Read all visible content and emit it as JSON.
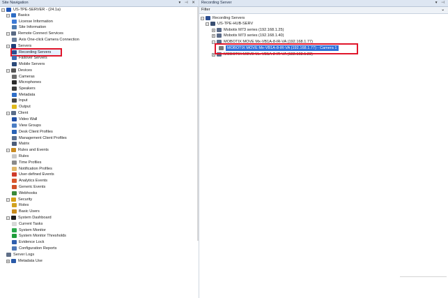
{
  "left_pane": {
    "title": "Site Navigation",
    "controls": "▾ ⊣ ✕",
    "tree": [
      {
        "label": "US-TPE-SERVER - (24.1a)",
        "icon": "server-root-icon",
        "color": "#1f56b8",
        "expand": "−"
      },
      {
        "label": "Basics",
        "icon": "folder-icon",
        "color": "#2d6cc4",
        "expand": "−"
      },
      {
        "label": "License Information",
        "icon": "license-icon",
        "color": "#3d7bd6"
      },
      {
        "label": "Site Information",
        "icon": "site-icon",
        "color": "#4a79b0"
      },
      {
        "label": "Remote Connect Services",
        "icon": "remote-icon",
        "color": "#5a6a84",
        "expand": "−"
      },
      {
        "label": "Axis One-click Camera Connection",
        "icon": "camera-connection-icon",
        "color": "#6a7f9c"
      },
      {
        "label": "Servers",
        "icon": "servers-icon",
        "color": "#1e3d78",
        "expand": "−"
      },
      {
        "label": "Recording Servers",
        "icon": "recording-server-icon",
        "color": "#2b4e92"
      },
      {
        "label": "Failover Servers",
        "icon": "failover-server-icon",
        "color": "#3b6cb2"
      },
      {
        "label": "Mobile Servers",
        "icon": "mobile-server-icon",
        "color": "#2b4a7a"
      },
      {
        "label": "Devices",
        "icon": "devices-icon",
        "color": "#555",
        "expand": "−"
      },
      {
        "label": "Cameras",
        "icon": "camera-icon",
        "color": "#6d6d6d"
      },
      {
        "label": "Microphones",
        "icon": "microphone-icon",
        "color": "#2b2b2b"
      },
      {
        "label": "Speakers",
        "icon": "speaker-icon",
        "color": "#3c3c3c"
      },
      {
        "label": "Metadata",
        "icon": "metadata-icon",
        "color": "#2f6ec8"
      },
      {
        "label": "Input",
        "icon": "input-icon",
        "color": "#474747"
      },
      {
        "label": "Output",
        "icon": "output-icon",
        "color": "#e0b91c"
      },
      {
        "label": "Client",
        "icon": "client-icon",
        "color": "#5b6e8a",
        "expand": "−"
      },
      {
        "label": "Video Wall",
        "icon": "video-wall-icon",
        "color": "#2251a8"
      },
      {
        "label": "View Groups",
        "icon": "view-groups-icon",
        "color": "#4a7dc4"
      },
      {
        "label": "Desk Client Profiles",
        "icon": "desk-client-icon",
        "color": "#2a63b6"
      },
      {
        "label": "Management Client Profiles",
        "icon": "management-client-icon",
        "color": "#5a6f90"
      },
      {
        "label": "Matrix",
        "icon": "matrix-icon",
        "color": "#4c5d7a"
      },
      {
        "label": "Rules and Events",
        "icon": "rules-events-icon",
        "color": "#c98a20",
        "expand": "−"
      },
      {
        "label": "Rules",
        "icon": "rules-icon",
        "color": "#c7c7c7"
      },
      {
        "label": "Time Profiles",
        "icon": "time-profiles-icon",
        "color": "#8a8a8a"
      },
      {
        "label": "Notification Profiles",
        "icon": "notification-icon",
        "color": "#e0b86a"
      },
      {
        "label": "User-defined Events",
        "icon": "user-event-icon",
        "color": "#cf3b2c"
      },
      {
        "label": "Analytics Events",
        "icon": "analytics-event-icon",
        "color": "#d9552c"
      },
      {
        "label": "Generic Events",
        "icon": "generic-event-icon",
        "color": "#d0502a"
      },
      {
        "label": "Webhooks",
        "icon": "webhooks-icon",
        "color": "#3a8a3a"
      },
      {
        "label": "Security",
        "icon": "security-icon",
        "color": "#d4a017",
        "expand": "−"
      },
      {
        "label": "Roles",
        "icon": "roles-icon",
        "color": "#d1a21f"
      },
      {
        "label": "Basic Users",
        "icon": "basic-users-icon",
        "color": "#c98b1c"
      },
      {
        "label": "System Dashboard",
        "icon": "dashboard-icon",
        "color": "#1e1e1e",
        "expand": "−"
      },
      {
        "label": "Current Tasks",
        "icon": "tasks-icon",
        "color": "#d8d8d8"
      },
      {
        "label": "System Monitor",
        "icon": "system-monitor-icon",
        "color": "#2aa84a"
      },
      {
        "label": "System Monitor Thresholds",
        "icon": "thresholds-icon",
        "color": "#1f9d3a"
      },
      {
        "label": "Evidence Lock",
        "icon": "evidence-lock-icon",
        "color": "#2f5fae"
      },
      {
        "label": "Configuration Reports",
        "icon": "reports-icon",
        "color": "#4f78b6"
      },
      {
        "label": "Server Logs",
        "icon": "server-logs-icon",
        "color": "#5f6f88"
      },
      {
        "label": "Metadata Use",
        "icon": "metadata-use-icon",
        "color": "#2a5aa8",
        "expand": "+"
      }
    ]
  },
  "right_pane": {
    "title": "Recording Server",
    "pin": "▾ ⊣",
    "filter_label": "Filter",
    "filter_chevron": "⌄",
    "tree": [
      {
        "label": "Recording Servers",
        "icon": "recording-servers-icon",
        "color": "#2b4e92",
        "expand": "−"
      },
      {
        "label": "US-TPE-HUB-SERV",
        "icon": "server-icon",
        "color": "#3a4f72",
        "expand": "−"
      },
      {
        "label": "Mobotix M73 series (192.168.1.25)",
        "icon": "hardware-icon",
        "color": "#5b6b88",
        "expand": "+"
      },
      {
        "label": "Mobotix M73 series (192.168.1.40)",
        "icon": "hardware-icon",
        "color": "#5b6b88",
        "expand": "+"
      },
      {
        "label": "MOBOTIX MOVE Mx-VB1A-8-IR-VA (192.168.1.77)",
        "icon": "hardware-icon",
        "color": "#5b6b88",
        "expand": "−"
      },
      {
        "label": "MOBOTIX MOVE Mx-VB1A-8-IR-VA (192.168.1.77) - Camera 1",
        "icon": "camera-icon",
        "color": "#7a7a7a"
      },
      {
        "label": "MOBOTIX MOVE Mx-VB1A-2-IR-VA (192.168.1.23)",
        "icon": "hardware-icon",
        "color": "#5b6b88",
        "expand": "+"
      }
    ]
  }
}
